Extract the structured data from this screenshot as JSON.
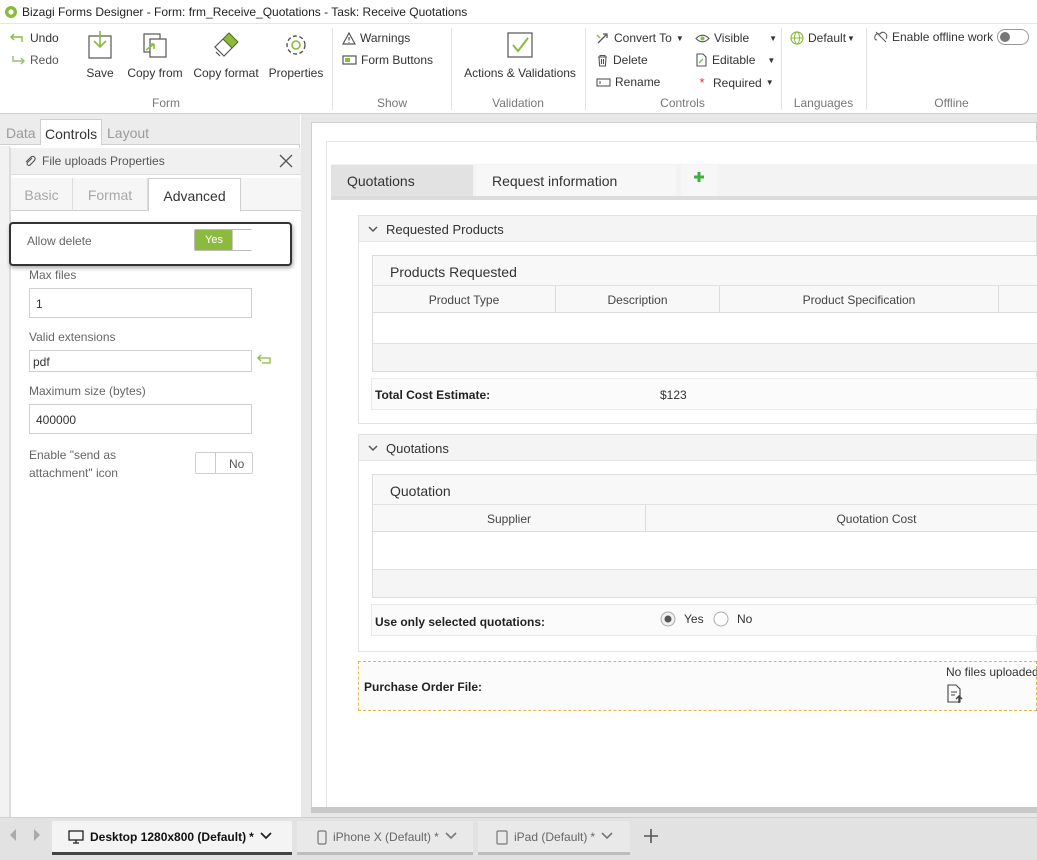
{
  "window": {
    "title": "Bizagi Forms Designer  -  Form: frm_Receive_Quotations - Task:  Receive Quotations"
  },
  "ribbon": {
    "form": {
      "undo": "Undo",
      "redo": "Redo",
      "save": "Save",
      "copy_from": "Copy from",
      "copy_format": "Copy format",
      "properties": "Properties",
      "group": "Form"
    },
    "show": {
      "warnings": "Warnings",
      "form_buttons": "Form Buttons",
      "group": "Show"
    },
    "validation": {
      "actions": "Actions & Validations",
      "group": "Validation"
    },
    "controls": {
      "convert_to": "Convert To",
      "delete": "Delete",
      "rename": "Rename",
      "visible": "Visible",
      "editable": "Editable",
      "required": "Required",
      "group": "Controls"
    },
    "languages": {
      "default": "Default",
      "group": "Languages"
    },
    "offline": {
      "enable": "Enable offline work",
      "group": "Offline"
    }
  },
  "left_tabs": [
    "Data",
    "Controls",
    "Layout"
  ],
  "props": {
    "title": "File uploads Properties",
    "tabs": [
      "Basic",
      "Format",
      "Advanced"
    ],
    "allow_delete": {
      "label": "Allow delete",
      "value": "Yes"
    },
    "max_files": {
      "label": "Max files",
      "value": "1"
    },
    "valid_extensions": {
      "label": "Valid extensions",
      "value": "pdf"
    },
    "max_size": {
      "label": "Maximum size (bytes)",
      "value": "400000"
    },
    "send_attachment": {
      "label_line1": "Enable \"send as",
      "label_line2": "attachment\" icon",
      "value": "No"
    }
  },
  "form": {
    "tabs": [
      "Quotations",
      "Request information"
    ],
    "requested_products": {
      "group": "Requested Products",
      "grid_title": "Products Requested",
      "columns": [
        "Product Type",
        "Description",
        "Product Specification"
      ],
      "total_label": "Total Cost Estimate:",
      "total_value": "$123"
    },
    "quotations": {
      "group": "Quotations",
      "grid_title": "Quotation",
      "columns": [
        "Supplier",
        "Quotation Cost"
      ],
      "use_label": "Use only selected quotations:",
      "yes": "Yes",
      "no": "No"
    },
    "purchase_order": {
      "label": "Purchase Order File:",
      "status": "No files uploaded"
    }
  },
  "devices": [
    {
      "label": "Desktop 1280x800 (Default)",
      "mark": "*"
    },
    {
      "label": "iPhone X (Default)",
      "mark": "*"
    },
    {
      "label": "iPad (Default)",
      "mark": "*"
    }
  ],
  "colors": {
    "accent": "#8cba3c",
    "focus_border": "#333333"
  }
}
